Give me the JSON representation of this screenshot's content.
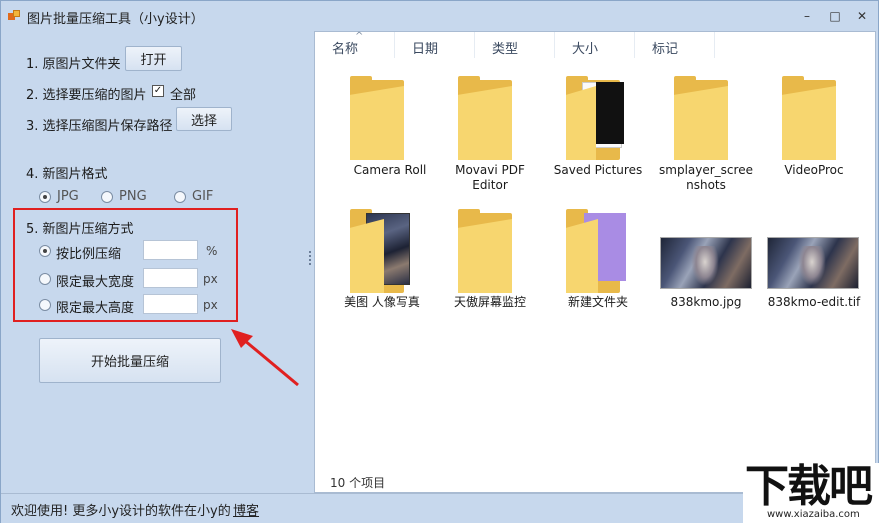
{
  "window": {
    "title": "图片批量压缩工具（小y设计）",
    "controls": {
      "minimize": "–",
      "maximize": "□",
      "close": "✕"
    }
  },
  "left": {
    "step1_label": "1. 原图片文件夹",
    "open_button": "打开",
    "step2_label": "2. 选择要压缩的图片",
    "select_all_label": "全部",
    "select_all_checked": true,
    "step3_label": "3. 选择压缩图片保存路径",
    "choose_button": "选择",
    "step4_label": "4. 新图片格式",
    "formats": [
      {
        "label": "JPG",
        "selected": true
      },
      {
        "label": "PNG",
        "selected": false
      },
      {
        "label": "GIF",
        "selected": false
      }
    ],
    "step5_label": "5. 新图片压缩方式",
    "modes": [
      {
        "label": "按比例压缩",
        "selected": true,
        "value": "",
        "unit": "%"
      },
      {
        "label": "限定最大宽度",
        "selected": false,
        "value": "",
        "unit": "px"
      },
      {
        "label": "限定最大高度",
        "selected": false,
        "value": "",
        "unit": "px"
      }
    ],
    "start_button": "开始批量压缩"
  },
  "explorer": {
    "columns": [
      "名称",
      "日期",
      "类型",
      "大小",
      "标记"
    ],
    "items": [
      {
        "name": "Camera Roll",
        "kind": "folder"
      },
      {
        "name": "Movavi PDF Editor",
        "kind": "folder"
      },
      {
        "name": "Saved Pictures",
        "kind": "folder-with-papers"
      },
      {
        "name": "smplayer_screenshots",
        "kind": "folder"
      },
      {
        "name": "VideoProc",
        "kind": "folder"
      },
      {
        "name": "美图 人像写真",
        "kind": "folder-with-image"
      },
      {
        "name": "天傲屏幕监控",
        "kind": "folder"
      },
      {
        "name": "新建文件夹",
        "kind": "folder-with-purple"
      },
      {
        "name": "838kmo.jpg",
        "kind": "image"
      },
      {
        "name": "838kmo-edit.tif",
        "kind": "image"
      }
    ],
    "item_count": "10 个项目"
  },
  "status": {
    "text": "欢迎使用! 更多小y设计的软件在小y的",
    "link": "博客"
  },
  "watermark": {
    "big": "下载吧",
    "small": "www.xiazaiba.com"
  },
  "colors": {
    "window_bg": "#c7d8ed",
    "annotation_red": "#e02020",
    "folder_yellow": "#f7d66f"
  }
}
